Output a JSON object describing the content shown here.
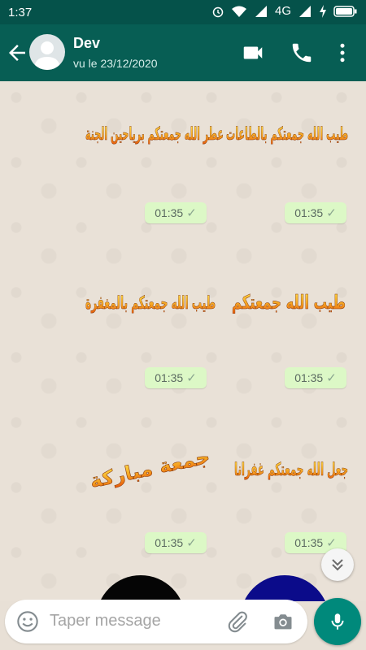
{
  "status_bar": {
    "time": "1:37",
    "network": "4G",
    "icons": [
      "alarm-icon",
      "wifi-icon",
      "signal-icon",
      "battery-icon"
    ]
  },
  "contact": {
    "name": "Dev",
    "last_seen": "vu le 23/12/2020"
  },
  "messages": [
    {
      "time": "01:35",
      "text": "عطر الله جمعتكم برياحين الجنة"
    },
    {
      "time": "01:35",
      "text": "طيب الله جمعتكم بالطاعات"
    },
    {
      "time": "01:35",
      "text": "طيب الله جمعتكم بالمغفرة"
    },
    {
      "time": "01:35",
      "text": "طيب الله جمعتكم"
    },
    {
      "time": "01:35",
      "text": "جمعة مباركة"
    },
    {
      "time": "01:35",
      "text": "جعل الله جمعتكم غفرانا"
    }
  ],
  "composer": {
    "placeholder": "Taper message"
  },
  "colors": {
    "header": "#075e54",
    "statusbar": "#05524a",
    "bubble": "#dcf8c6",
    "accent": "#00897b"
  }
}
